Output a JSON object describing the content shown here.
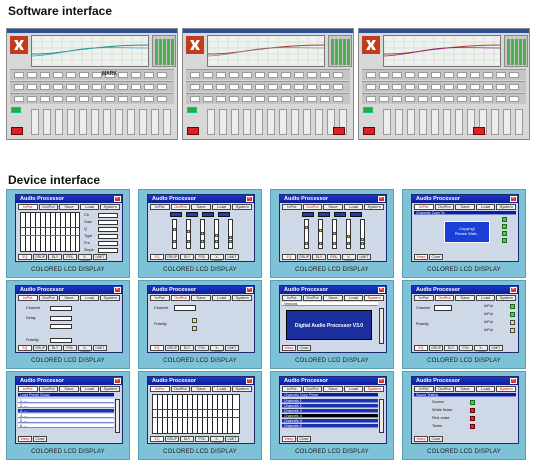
{
  "software_section": {
    "title": "Software interface",
    "brand_text": "MARK"
  },
  "device_section": {
    "title": "Device interface",
    "caption": "COLORED LCD DISPLAY",
    "lcd_header": "Audio Processor",
    "tabs": [
      "InPut",
      "OutPut",
      "Save",
      "Load",
      "System"
    ],
    "versions_label": "Versions",
    "version_text": "Digital Audio Processor V3.0",
    "dialog_line1": "Copying!",
    "dialog_line2": "Please Wait...",
    "copy_header": "Channels Copy To",
    "copy_prese_header": "Channels Copy Prese",
    "load_header": "Load Preset Group",
    "sound_header": "Sound Testing",
    "channel_label": "Channel",
    "polarity_label": "Polarity",
    "delay_label": "Delay",
    "noise_items": [
      "Source",
      "White Noise",
      "Pink noise",
      "Tones"
    ],
    "footer_tabs": [
      "Weep",
      "Close"
    ],
    "footer_tabs_full": [
      "EQ",
      "GRUP",
      "DLY",
      "POL",
      "X-OVER",
      "LIMIT"
    ]
  },
  "colors": {
    "lcd_title": "#1e36c8",
    "panel_bg": "#7dc2d6",
    "logo_red": "#c23b1c"
  }
}
